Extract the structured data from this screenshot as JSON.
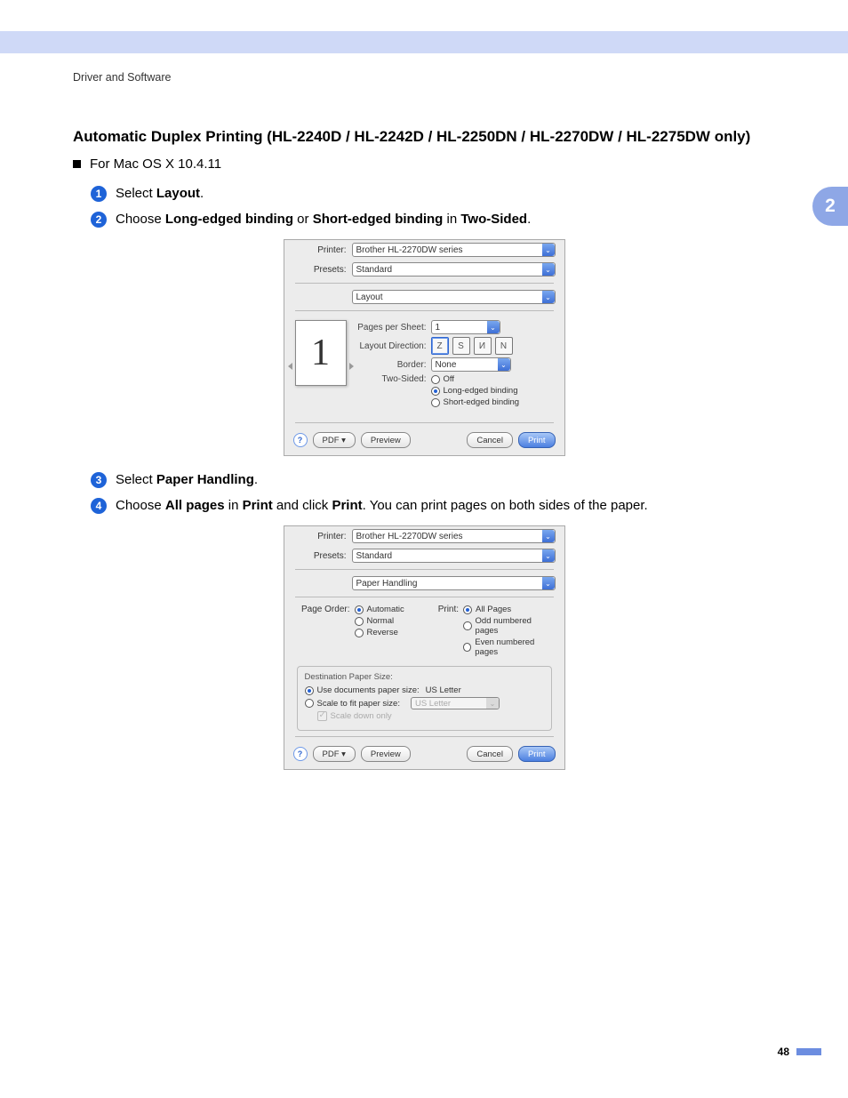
{
  "breadcrumb": "Driver and Software",
  "title": "Automatic Duplex Printing (HL-2240D / HL-2242D / HL-2250DN / HL-2270DW / HL-2275DW only)",
  "os_line": "For Mac OS X 10.4.11",
  "steps": {
    "s1_pre": "Select ",
    "s1_b": "Layout",
    "s1_post": ".",
    "s2_pre": "Choose ",
    "s2_b1": "Long-edged binding",
    "s2_mid": " or ",
    "s2_b2": "Short-edged binding",
    "s2_mid2": " in ",
    "s2_b3": "Two-Sided",
    "s2_post": ".",
    "s3_pre": "Select ",
    "s3_b": "Paper Handling",
    "s3_post": ".",
    "s4_pre": "Choose ",
    "s4_b1": "All pages",
    "s4_mid1": " in ",
    "s4_b2": "Print",
    "s4_mid2": " and click ",
    "s4_b3": "Print",
    "s4_post": ". You can print pages on both sides of the paper."
  },
  "dialog1": {
    "printer_label": "Printer:",
    "printer_value": "Brother HL-2270DW series",
    "presets_label": "Presets:",
    "presets_value": "Standard",
    "pane_value": "Layout",
    "pages_per_sheet_label": "Pages per Sheet:",
    "pages_per_sheet_value": "1",
    "layout_direction_label": "Layout Direction:",
    "border_label": "Border:",
    "border_value": "None",
    "two_sided_label": "Two-Sided:",
    "two_sided_off": "Off",
    "two_sided_long": "Long-edged binding",
    "two_sided_short": "Short-edged binding",
    "page_preview_number": "1",
    "btn_pdf": "PDF ▾",
    "btn_preview": "Preview",
    "btn_cancel": "Cancel",
    "btn_print": "Print"
  },
  "dialog2": {
    "printer_label": "Printer:",
    "printer_value": "Brother HL-2270DW series",
    "presets_label": "Presets:",
    "presets_value": "Standard",
    "pane_value": "Paper Handling",
    "page_order_label": "Page Order:",
    "po_auto": "Automatic",
    "po_normal": "Normal",
    "po_reverse": "Reverse",
    "print_label": "Print:",
    "pr_all": "All Pages",
    "pr_odd": "Odd numbered pages",
    "pr_even": "Even numbered pages",
    "dest_legend": "Destination Paper Size:",
    "use_doc": "Use documents paper size:",
    "us_letter": "US Letter",
    "scale_fit": "Scale to fit paper size:",
    "scale_down": "Scale down only",
    "btn_pdf": "PDF ▾",
    "btn_preview": "Preview",
    "btn_cancel": "Cancel",
    "btn_print": "Print"
  },
  "chapter_tab": "2",
  "page_number": "48"
}
